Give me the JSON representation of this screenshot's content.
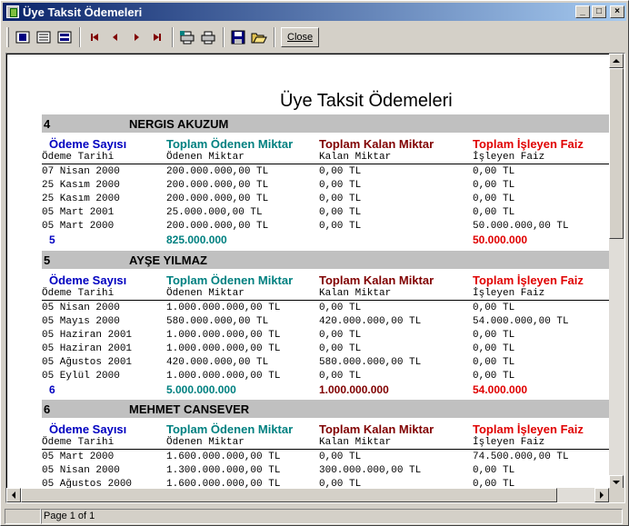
{
  "window": {
    "title": "Üye Taksit Ödemeleri"
  },
  "titlebar_buttons": {
    "minimize": "_",
    "maximize": "□",
    "close": "×"
  },
  "toolbar": {
    "icons": [
      "single-page-icon",
      "multi-page-icon",
      "page-width-icon",
      "first-page-icon",
      "prev-page-icon",
      "next-page-icon",
      "last-page-icon",
      "printer-setup-icon",
      "print-icon",
      "save-icon",
      "open-icon"
    ],
    "close_label": "Close"
  },
  "colors": {
    "count": "#0000c0",
    "paid": "#008080",
    "remaining": "#800000",
    "interest": "#e00000",
    "group_bg": "#c0c0c0"
  },
  "report": {
    "title": "Üye Taksit Ödemeleri",
    "headings": {
      "count": "Ödeme Sayısı",
      "paid": "Toplam Ödenen Miktar",
      "remaining": "Toplam Kalan Miktar",
      "interest": "Toplam İşleyen Faiz"
    },
    "subheadings": {
      "date": "Ödeme Tarihi",
      "paid": "Ödenen Miktar",
      "remaining": "Kalan Miktar",
      "interest": "İşleyen Faiz"
    },
    "groups": [
      {
        "id": "4",
        "name": "NERGIS AKUZUM",
        "rows": [
          {
            "date": "07 Nisan 2000",
            "paid": "200.000.000,00 TL",
            "remaining": "0,00 TL",
            "interest": "0,00 TL"
          },
          {
            "date": "25 Kasım 2000",
            "paid": "200.000.000,00 TL",
            "remaining": "0,00 TL",
            "interest": "0,00 TL"
          },
          {
            "date": "25 Kasım 2000",
            "paid": "200.000.000,00 TL",
            "remaining": "0,00 TL",
            "interest": "0,00 TL"
          },
          {
            "date": "05 Mart 2001",
            "paid": "25.000.000,00 TL",
            "remaining": "0,00 TL",
            "interest": "0,00 TL"
          },
          {
            "date": "05 Mart 2000",
            "paid": "200.000.000,00 TL",
            "remaining": "0,00 TL",
            "interest": "50.000.000,00 TL"
          }
        ],
        "totals": {
          "count": "5",
          "paid": "825.000.000",
          "remaining": "",
          "interest": "50.000.000"
        }
      },
      {
        "id": "5",
        "name": "AYŞE YILMAZ",
        "rows": [
          {
            "date": "05 Nisan 2000",
            "paid": "1.000.000.000,00 TL",
            "remaining": "0,00 TL",
            "interest": "0,00 TL"
          },
          {
            "date": "05 Mayıs 2000",
            "paid": "580.000.000,00 TL",
            "remaining": "420.000.000,00 TL",
            "interest": "54.000.000,00 TL"
          },
          {
            "date": "05 Haziran 2001",
            "paid": "1.000.000.000,00 TL",
            "remaining": "0,00 TL",
            "interest": "0,00 TL"
          },
          {
            "date": "05 Haziran 2001",
            "paid": "1.000.000.000,00 TL",
            "remaining": "0,00 TL",
            "interest": "0,00 TL"
          },
          {
            "date": "05 Ağustos 2001",
            "paid": "420.000.000,00 TL",
            "remaining": "580.000.000,00 TL",
            "interest": "0,00 TL"
          },
          {
            "date": "05 Eylül 2000",
            "paid": "1.000.000.000,00 TL",
            "remaining": "0,00 TL",
            "interest": "0,00 TL"
          }
        ],
        "totals": {
          "count": "6",
          "paid": "5.000.000.000",
          "remaining": "1.000.000.000",
          "interest": "54.000.000"
        }
      },
      {
        "id": "6",
        "name": "MEHMET CANSEVER",
        "rows": [
          {
            "date": "05 Mart 2000",
            "paid": "1.600.000.000,00 TL",
            "remaining": "0,00 TL",
            "interest": "74.500.000,00 TL"
          },
          {
            "date": "05 Nisan 2000",
            "paid": "1.300.000.000,00 TL",
            "remaining": "300.000.000,00 TL",
            "interest": "0,00 TL"
          },
          {
            "date": "05 Ağustos 2000",
            "paid": "1.600.000.000,00 TL",
            "remaining": "0,00 TL",
            "interest": "0,00 TL"
          }
        ],
        "totals": null
      }
    ]
  },
  "statusbar": {
    "page": "Page 1 of 1"
  }
}
